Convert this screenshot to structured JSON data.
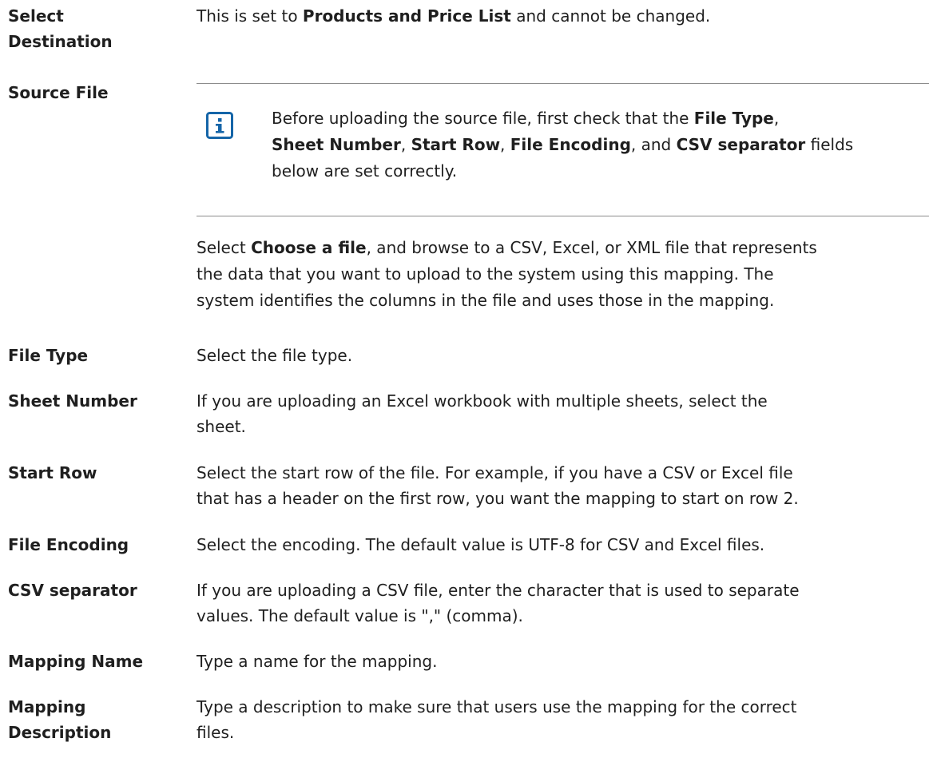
{
  "rows": {
    "select_destination": {
      "term_line1": "Select",
      "term_line2": "Destination",
      "desc_a": "This is set to ",
      "desc_b": "Products and Price List",
      "desc_c": " and cannot be changed."
    },
    "source_file": {
      "term": "Source File",
      "note": {
        "icon": "info-icon",
        "icon_color": "#1565a8",
        "l1_a": "Before uploading the source file, first check that the ",
        "l1_b": "File Type",
        "l1_c": ",",
        "l2_a": "Sheet Number",
        "l2_b": ", ",
        "l2_c": "Start Row",
        "l2_d": ", ",
        "l2_e": "File Encoding",
        "l2_f": ", and ",
        "l2_g": "CSV separator",
        "l2_h": " fields",
        "l3": "below are set correctly."
      },
      "desc_l1_a": "Select ",
      "desc_l1_b": "Choose a file",
      "desc_l1_c": ", and browse to a CSV, Excel, or XML file that represents",
      "desc_l2": "the data that you want to upload to the system using this mapping. The",
      "desc_l3": "system identifies the columns in the file and uses those in the mapping."
    },
    "file_type": {
      "term": "File Type",
      "desc": "Select the file type."
    },
    "sheet_number": {
      "term": "Sheet Number",
      "desc_l1": "If you are uploading an Excel workbook with multiple sheets, select the",
      "desc_l2": "sheet."
    },
    "start_row": {
      "term": "Start Row",
      "desc_l1": "Select the start row of the file. For example, if you have a CSV or Excel file",
      "desc_l2": "that has a header on the first row, you want the mapping to start on row 2."
    },
    "file_encoding": {
      "term": "File Encoding",
      "desc": "Select the encoding. The default value is UTF-8 for CSV and Excel files."
    },
    "csv_separator": {
      "term": "CSV separator",
      "desc_l1": "If you are uploading a CSV file, enter the character that is used to separate",
      "desc_l2": "values. The default value is \",\" (comma)."
    },
    "mapping_name": {
      "term": "Mapping Name",
      "desc": "Type a name for the mapping."
    },
    "mapping_description": {
      "term_line1": "Mapping",
      "term_line2": "Description",
      "desc_l1": "Type a description to make sure that users use the mapping for the correct",
      "desc_l2": "files."
    }
  }
}
